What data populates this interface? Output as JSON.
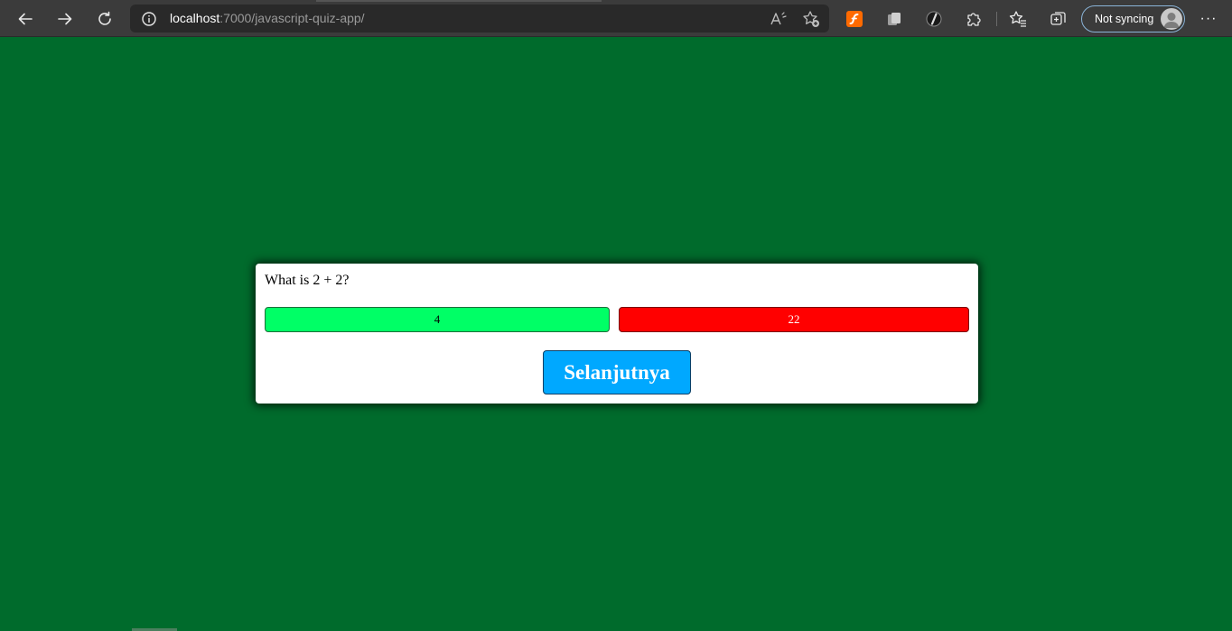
{
  "browser": {
    "url_host": "localhost",
    "url_path": ":7000/javascript-quiz-app/",
    "sync_label": "Not syncing",
    "menu_glyph": "···"
  },
  "quiz": {
    "question": "What is 2 + 2?",
    "answers": [
      {
        "label": "4",
        "state": "correct"
      },
      {
        "label": "22",
        "state": "wrong"
      }
    ],
    "next_label": "Selanjutnya"
  },
  "colors": {
    "page_background": "#006b2c",
    "correct": "#00ff66",
    "wrong": "#ff0000",
    "next_button": "#00a8ff"
  }
}
